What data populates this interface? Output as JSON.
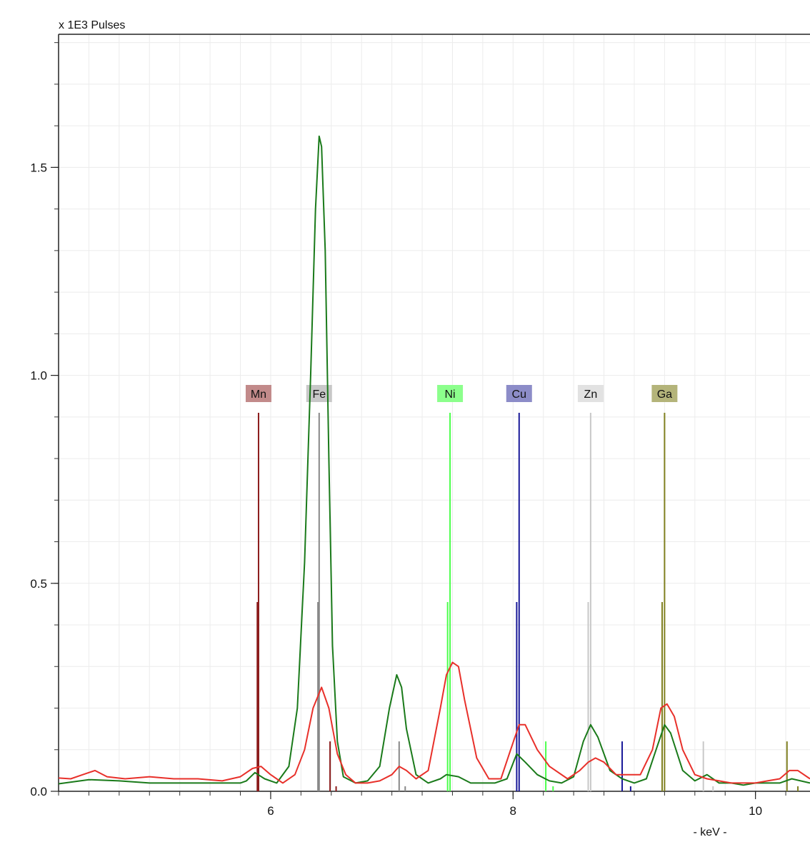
{
  "chart_data": {
    "type": "line",
    "y_unit_label": "x 1E3 Pulses",
    "x_unit_label": "- keV -",
    "xlim": [
      4.25,
      10.45
    ],
    "ylim": [
      0.0,
      1.82
    ],
    "x_ticks": [
      {
        "value": 6,
        "label": "6"
      },
      {
        "value": 8,
        "label": "8"
      },
      {
        "value": 10,
        "label": "10"
      }
    ],
    "y_ticks": [
      {
        "value": 0.0,
        "label": "0.0"
      },
      {
        "value": 0.5,
        "label": "0.5"
      },
      {
        "value": 1.0,
        "label": "1.0"
      },
      {
        "value": 1.5,
        "label": "1.5"
      }
    ],
    "x_minor_step": 0.25,
    "y_minor_step": 0.1,
    "grid": true,
    "series": [
      {
        "color": "#1a7a1a",
        "x": [
          4.25,
          4.5,
          4.75,
          5.0,
          5.25,
          5.5,
          5.75,
          5.8,
          5.87,
          5.95,
          6.05,
          6.15,
          6.22,
          6.28,
          6.33,
          6.37,
          6.4,
          6.42,
          6.45,
          6.48,
          6.51,
          6.55,
          6.6,
          6.7,
          6.8,
          6.9,
          6.98,
          7.04,
          7.08,
          7.12,
          7.2,
          7.3,
          7.4,
          7.45,
          7.55,
          7.65,
          7.75,
          7.85,
          7.95,
          8.03,
          8.1,
          8.2,
          8.3,
          8.4,
          8.5,
          8.58,
          8.64,
          8.7,
          8.8,
          8.9,
          9.0,
          9.1,
          9.18,
          9.25,
          9.3,
          9.4,
          9.5,
          9.6,
          9.7,
          9.8,
          9.9,
          10.0,
          10.1,
          10.2,
          10.3,
          10.45
        ],
        "values": [
          0.018,
          0.028,
          0.025,
          0.02,
          0.02,
          0.02,
          0.02,
          0.025,
          0.045,
          0.03,
          0.02,
          0.06,
          0.2,
          0.55,
          1.0,
          1.4,
          1.575,
          1.55,
          1.3,
          0.8,
          0.35,
          0.12,
          0.035,
          0.02,
          0.025,
          0.06,
          0.2,
          0.28,
          0.25,
          0.15,
          0.04,
          0.02,
          0.03,
          0.04,
          0.035,
          0.02,
          0.02,
          0.02,
          0.03,
          0.09,
          0.07,
          0.04,
          0.025,
          0.02,
          0.035,
          0.12,
          0.16,
          0.13,
          0.05,
          0.03,
          0.02,
          0.03,
          0.1,
          0.16,
          0.14,
          0.05,
          0.025,
          0.04,
          0.02,
          0.02,
          0.015,
          0.02,
          0.02,
          0.02,
          0.03,
          0.02
        ]
      },
      {
        "color": "#e8302a",
        "x": [
          4.25,
          4.35,
          4.45,
          4.55,
          4.65,
          4.8,
          5.0,
          5.2,
          5.4,
          5.6,
          5.75,
          5.85,
          5.92,
          6.0,
          6.1,
          6.2,
          6.28,
          6.35,
          6.42,
          6.48,
          6.55,
          6.62,
          6.7,
          6.8,
          6.9,
          7.0,
          7.06,
          7.12,
          7.2,
          7.3,
          7.4,
          7.45,
          7.5,
          7.55,
          7.6,
          7.7,
          7.8,
          7.9,
          7.98,
          8.05,
          8.1,
          8.2,
          8.3,
          8.45,
          8.55,
          8.62,
          8.68,
          8.75,
          8.85,
          8.95,
          9.05,
          9.15,
          9.22,
          9.27,
          9.33,
          9.4,
          9.5,
          9.6,
          9.7,
          9.8,
          9.9,
          10.0,
          10.1,
          10.2,
          10.28,
          10.35,
          10.45
        ],
        "values": [
          0.032,
          0.03,
          0.04,
          0.05,
          0.035,
          0.03,
          0.035,
          0.03,
          0.03,
          0.025,
          0.035,
          0.055,
          0.06,
          0.04,
          0.02,
          0.04,
          0.1,
          0.2,
          0.25,
          0.2,
          0.09,
          0.04,
          0.02,
          0.02,
          0.025,
          0.04,
          0.06,
          0.05,
          0.03,
          0.05,
          0.2,
          0.28,
          0.31,
          0.3,
          0.22,
          0.08,
          0.03,
          0.03,
          0.1,
          0.16,
          0.16,
          0.1,
          0.06,
          0.03,
          0.05,
          0.07,
          0.08,
          0.07,
          0.04,
          0.04,
          0.04,
          0.1,
          0.2,
          0.21,
          0.18,
          0.1,
          0.04,
          0.03,
          0.025,
          0.02,
          0.02,
          0.02,
          0.025,
          0.03,
          0.05,
          0.05,
          0.03
        ]
      }
    ],
    "element_markers": [
      {
        "element": "Mn",
        "color": "#8b1a1a",
        "label_bg": "#c28a8a",
        "lines": [
          {
            "x": 5.9,
            "h": 0.91
          },
          {
            "x": 5.89,
            "h": 0.455
          },
          {
            "x": 6.49,
            "h": 0.12
          },
          {
            "x": 6.54,
            "h": 0.012
          }
        ]
      },
      {
        "element": "Fe",
        "color": "#888888",
        "label_bg": "#c8c8c8",
        "lines": [
          {
            "x": 6.4,
            "h": 0.91
          },
          {
            "x": 6.39,
            "h": 0.455
          },
          {
            "x": 7.06,
            "h": 0.12
          },
          {
            "x": 7.11,
            "h": 0.012
          }
        ]
      },
      {
        "element": "Ni",
        "color": "#4cff4c",
        "label_bg": "#8cff8c",
        "lines": [
          {
            "x": 7.48,
            "h": 0.91
          },
          {
            "x": 7.46,
            "h": 0.455
          },
          {
            "x": 8.27,
            "h": 0.12
          },
          {
            "x": 8.33,
            "h": 0.012
          }
        ]
      },
      {
        "element": "Cu",
        "color": "#1a1a99",
        "label_bg": "#8c8cc8",
        "lines": [
          {
            "x": 8.05,
            "h": 0.91
          },
          {
            "x": 8.03,
            "h": 0.455
          },
          {
            "x": 8.9,
            "h": 0.12
          },
          {
            "x": 8.97,
            "h": 0.012
          }
        ]
      },
      {
        "element": "Zn",
        "color": "#c8c8c8",
        "label_bg": "#e2e2e2",
        "lines": [
          {
            "x": 8.64,
            "h": 0.91
          },
          {
            "x": 8.62,
            "h": 0.455
          },
          {
            "x": 9.57,
            "h": 0.12
          },
          {
            "x": 9.65,
            "h": 0.012
          }
        ]
      },
      {
        "element": "Ga",
        "color": "#808020",
        "label_bg": "#b4b47a",
        "lines": [
          {
            "x": 9.25,
            "h": 0.91
          },
          {
            "x": 9.23,
            "h": 0.455
          },
          {
            "x": 10.26,
            "h": 0.12
          },
          {
            "x": 10.35,
            "h": 0.012
          }
        ]
      }
    ]
  }
}
